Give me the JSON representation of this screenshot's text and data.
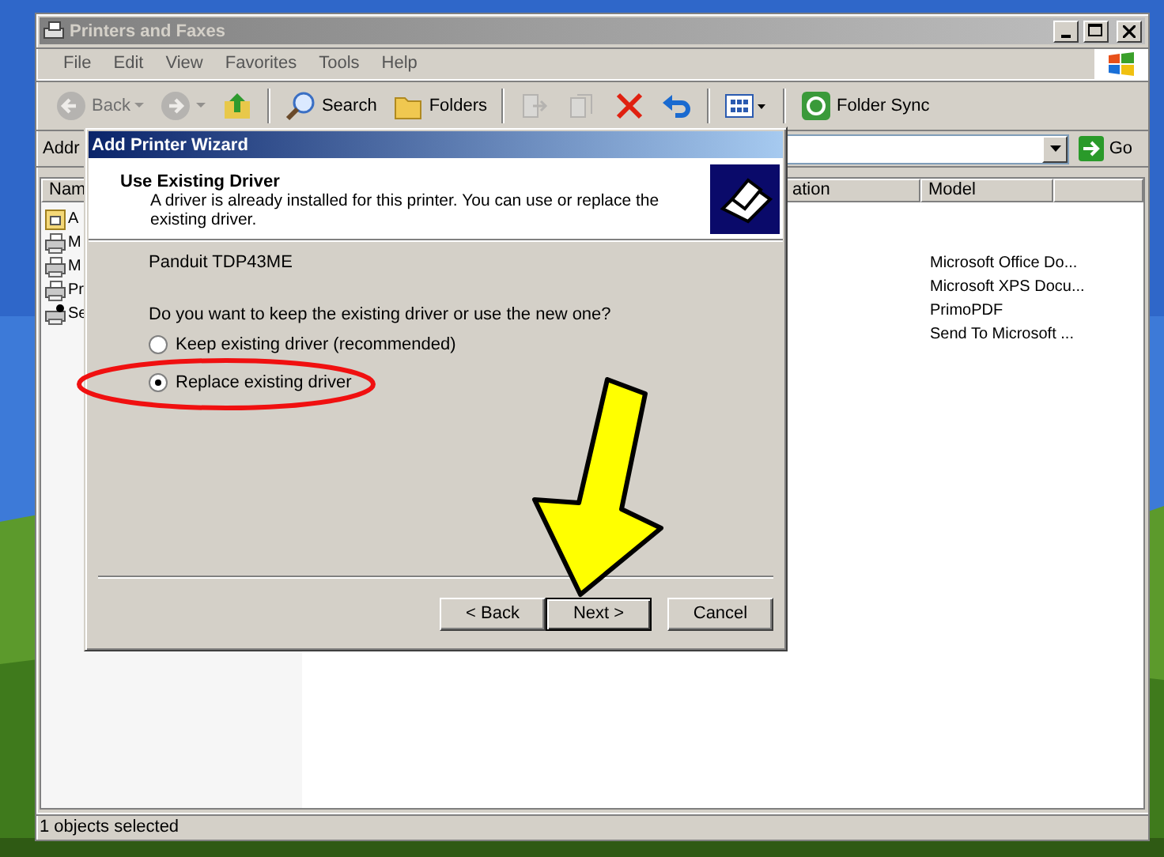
{
  "window": {
    "title": "Printers and Faxes"
  },
  "menu": [
    "File",
    "Edit",
    "View",
    "Favorites",
    "Tools",
    "Help"
  ],
  "toolbar": [
    {
      "kind": "back",
      "label": "Back",
      "disabled": true
    },
    {
      "kind": "forward",
      "disabled": true
    },
    {
      "kind": "up",
      "disabled": false
    },
    {
      "kind": "search",
      "label": "Search",
      "disabled": false
    },
    {
      "kind": "folders",
      "label": "Folders",
      "disabled": false
    },
    {
      "kind": "move",
      "disabled": true
    },
    {
      "kind": "copy",
      "disabled": true
    },
    {
      "kind": "delete",
      "disabled": false
    },
    {
      "kind": "undo",
      "disabled": false
    },
    {
      "kind": "views",
      "disabled": false
    },
    {
      "kind": "sync",
      "label": "Folder Sync",
      "disabled": false
    }
  ],
  "address": {
    "label": "Addr",
    "go": "Go"
  },
  "columns": [
    "Nam",
    "ation",
    "Model"
  ],
  "items": [
    {
      "kind": "add",
      "name": "A"
    },
    {
      "kind": "printer",
      "name": "M",
      "model": "Microsoft Office Do..."
    },
    {
      "kind": "printer",
      "name": "M",
      "model": "Microsoft XPS Docu..."
    },
    {
      "kind": "printer",
      "name": "Pr",
      "model": "PrimoPDF"
    },
    {
      "kind": "default",
      "name": "Se",
      "model": "Send To Microsoft ..."
    }
  ],
  "status_bar": "1 objects selected",
  "dialog": {
    "title": "Add Printer Wizard",
    "heading": "Use Existing Driver",
    "description": "A driver is already installed for this printer. You can use or replace the existing driver.",
    "printer": "Panduit TDP43ME",
    "question": "Do you want to keep the existing driver or use the new one?",
    "options": [
      {
        "label": "Keep existing driver (recommended)",
        "selected": false
      },
      {
        "label": "Replace existing driver",
        "selected": true
      }
    ],
    "buttons": [
      {
        "label": "< Back",
        "default": false
      },
      {
        "label": "Next >",
        "default": true
      },
      {
        "label": "Cancel",
        "default": false
      }
    ]
  }
}
